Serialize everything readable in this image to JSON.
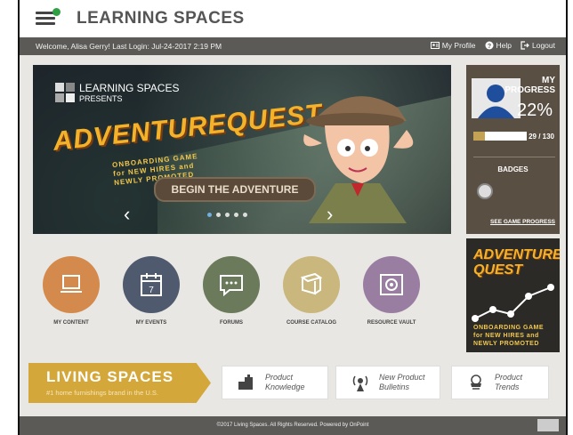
{
  "app": {
    "title": "LEARNING SPACES"
  },
  "userbar": {
    "welcome": "Welcome, Alisa Gerry!   Last Login: Jul-24-2017 2:19 PM",
    "links": [
      {
        "label": "My Profile",
        "icon": "profile-icon"
      },
      {
        "label": "Help",
        "icon": "help-icon"
      },
      {
        "label": "Logout",
        "icon": "logout-icon"
      }
    ]
  },
  "hero": {
    "brand_line1": "LEARNING SPACES",
    "brand_line2": "PRESENTS",
    "game_title": "ADVENTUREQUEST",
    "subtitle_line1": "ONBOARDING GAME",
    "subtitle_line2": "for NEW HIRES and",
    "subtitle_line3": "NEWLY PROMOTED",
    "cta": "BEGIN THE ADVENTURE",
    "prev": "‹",
    "next": "›",
    "slide_count": 5,
    "active_slide": 1
  },
  "progress": {
    "label_line1": "MY",
    "label_line2": "PROGRESS",
    "percent": "22%",
    "fraction": 0.22,
    "count": "29 / 130",
    "badges_label": "BADGES",
    "see_link": "SEE GAME PROGRESS"
  },
  "nav": [
    {
      "label": "MY CONTENT",
      "color": "#d48a4c",
      "icon": "laptop-icon"
    },
    {
      "label": "MY EVENTS",
      "color": "#4f5a6f",
      "icon": "calendar-icon",
      "icon_text": "7"
    },
    {
      "label": "FORUMS",
      "color": "#6a7a5a",
      "icon": "chat-icon"
    },
    {
      "label": "COURSE CATALOG",
      "color": "#c9b77e",
      "icon": "book-icon"
    },
    {
      "label": "RESOURCE VAULT",
      "color": "#9a7ea2",
      "icon": "vault-icon"
    }
  ],
  "promo": {
    "title_line1": "ADVENTURE",
    "title_line2": "QUEST",
    "sub_line1": "ONBOARDING GAME",
    "sub_line2": "for NEW HIRES and",
    "sub_line3": "NEWLY PROMOTED"
  },
  "banner": {
    "title": "LIVING SPACES",
    "subtitle": "#1 home furnishings brand in the U.S."
  },
  "cards": [
    {
      "line1": "Product",
      "line2": "Knowledge",
      "icon": "product-knowledge-icon"
    },
    {
      "line1": "New Product",
      "line2": "Bulletins",
      "icon": "bulletins-icon"
    },
    {
      "line1": "Product",
      "line2": "Trends",
      "icon": "trends-icon"
    }
  ],
  "footer": {
    "text": "©2017 Living Spaces. All Rights Reserved. Powered by OnPoint"
  }
}
